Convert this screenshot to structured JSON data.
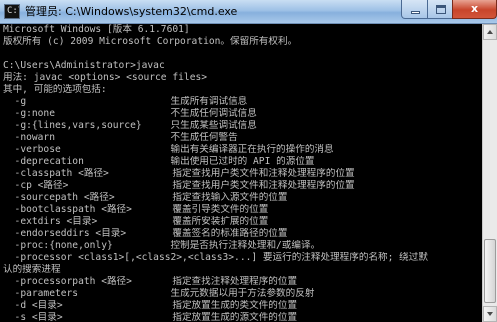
{
  "window": {
    "title": "管理员: C:\\Windows\\system32\\cmd.exe",
    "icon_text": "C:\\",
    "icon": "cmd-icon",
    "controls": {
      "minimize": "minimize-icon",
      "maximize": "maximize-icon",
      "close_label": "x"
    },
    "colors": {
      "console_bg": "#000000",
      "console_text": "#c0c0c0",
      "titlebar": "#9fc1e6",
      "close": "#c8452b"
    }
  },
  "console": {
    "lines": [
      "Microsoft Windows [版本 6.1.7601]",
      "版权所有 (c) 2009 Microsoft Corporation。保留所有权利。",
      "",
      "C:\\Users\\Administrator>javac",
      "用法: javac <options> <source files>",
      "其中, 可能的选项包括:",
      "  -g                         生成所有调试信息",
      "  -g:none                    不生成任何调试信息",
      "  -g:{lines,vars,source}     只生成某些调试信息",
      "  -nowarn                    不生成任何警告",
      "  -verbose                   输出有关编译器正在执行的操作的消息",
      "  -deprecation               输出使用已过时的 API 的源位置",
      "  -classpath <路径>           指定查找用户类文件和注释处理程序的位置",
      "  -cp <路径>                  指定查找用户类文件和注释处理程序的位置",
      "  -sourcepath <路径>          指定查找输入源文件的位置",
      "  -bootclasspath <路径>       覆盖引导类文件的位置",
      "  -extdirs <目录>             覆盖所安装扩展的位置",
      "  -endorseddirs <目录>        覆盖签名的标准路径的位置",
      "  -proc:{none,only}          控制是否执行注释处理和/或编译。",
      "  -processor <class1>[,<class2>,<class3>...] 要运行的注释处理程序的名称; 绕过默",
      "认的搜索进程",
      "  -processorpath <路径>       指定查找注释处理程序的位置",
      "  -parameters                生成元数据以用于方法参数的反射",
      "  -d <目录>                   指定放置生成的类文件的位置",
      "  -s <目录>                   指定放置生成的源文件的位置"
    ]
  },
  "scrollbar": {
    "up_icon": "scroll-up-arrow-icon",
    "down_icon": "scroll-down-arrow-icon",
    "position_fraction": 0.78
  }
}
